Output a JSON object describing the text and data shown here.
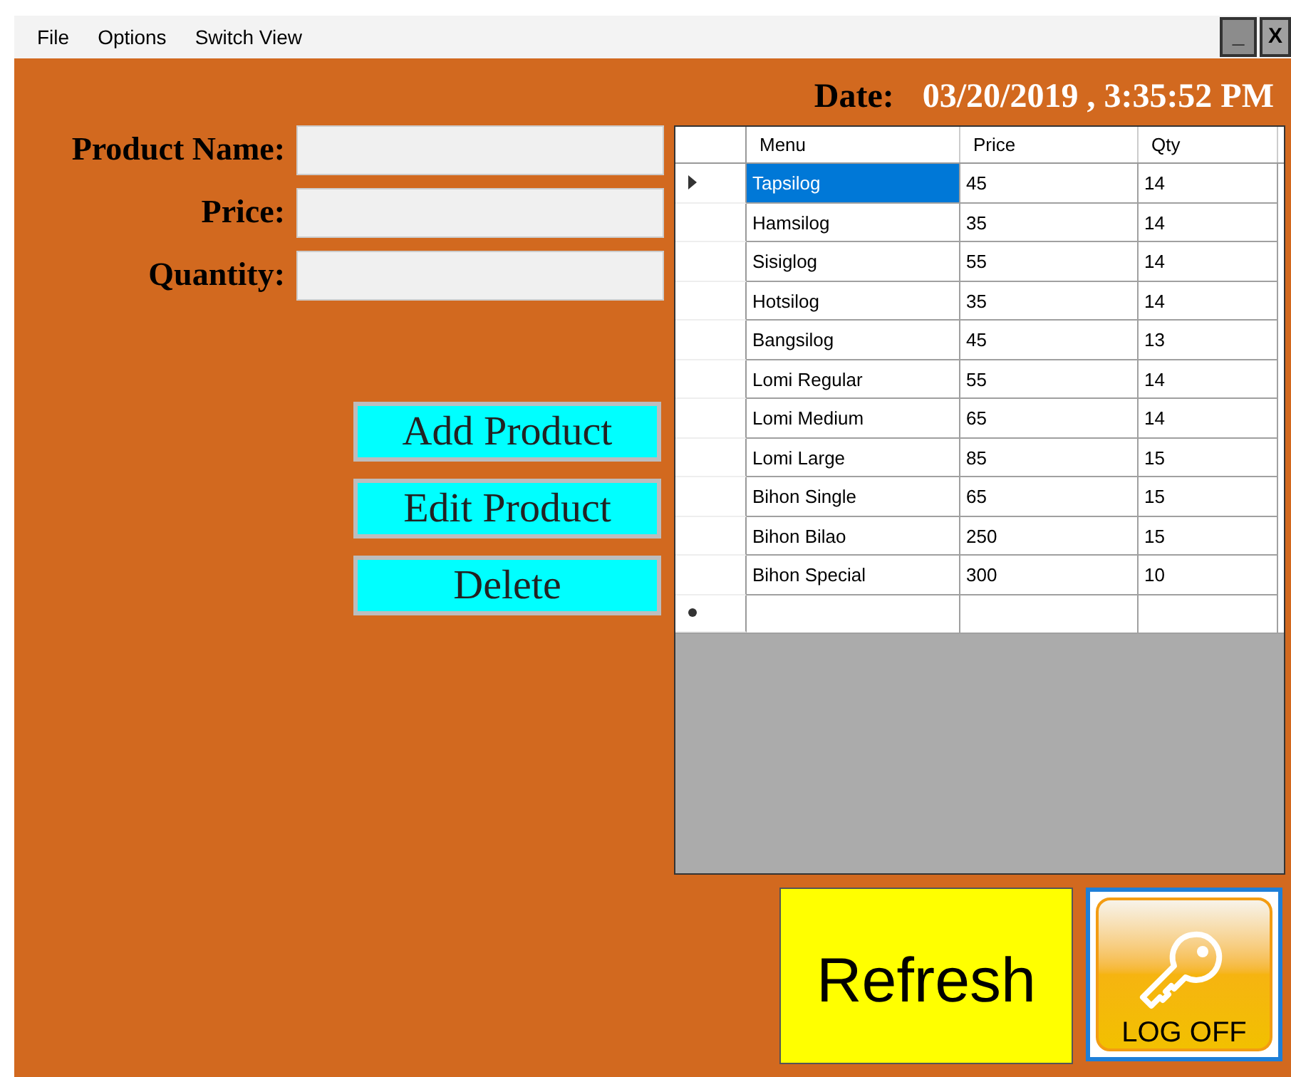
{
  "menu_bar": {
    "items": [
      "File",
      "Options",
      "Switch View"
    ]
  },
  "window_controls": [
    {
      "kind": "minimize",
      "glyph": "_"
    },
    {
      "kind": "close",
      "glyph": "X"
    }
  ],
  "date": {
    "label": "Date:",
    "value": "03/20/2019 , 3:35:52 PM"
  },
  "form": {
    "fields": [
      {
        "label": "Product Name:"
      },
      {
        "label": "Price:"
      },
      {
        "label": "Quantity:"
      }
    ]
  },
  "actions": [
    "Add Product",
    "Edit Product",
    "Delete"
  ],
  "table": {
    "columns": [
      "Menu",
      "Price",
      "Qty"
    ],
    "rows": [
      {
        "cells": [
          "Tapsilog",
          "45",
          "14"
        ],
        "selected": true
      },
      {
        "cells": [
          "Hamsilog",
          "35",
          "14"
        ],
        "selected": false
      },
      {
        "cells": [
          "Sisiglog",
          "55",
          "14"
        ],
        "selected": false
      },
      {
        "cells": [
          "Hotsilog",
          "35",
          "14"
        ],
        "selected": false
      },
      {
        "cells": [
          "Bangsilog",
          "45",
          "13"
        ],
        "selected": false
      },
      {
        "cells": [
          "Lomi Regular",
          "55",
          "14"
        ],
        "selected": false
      },
      {
        "cells": [
          "Lomi Medium",
          "65",
          "14"
        ],
        "selected": false
      },
      {
        "cells": [
          "Lomi Large",
          "85",
          "15"
        ],
        "selected": false
      },
      {
        "cells": [
          "Bihon Single",
          "65",
          "15"
        ],
        "selected": false
      },
      {
        "cells": [
          "Bihon Bilao",
          "250",
          "15"
        ],
        "selected": false
      },
      {
        "cells": [
          "Bihon Special",
          "300",
          "10"
        ],
        "selected": false
      }
    ]
  },
  "refresh_button": {
    "label": "Refresh"
  },
  "log_off_button": {
    "label": "LOG OFF"
  }
}
